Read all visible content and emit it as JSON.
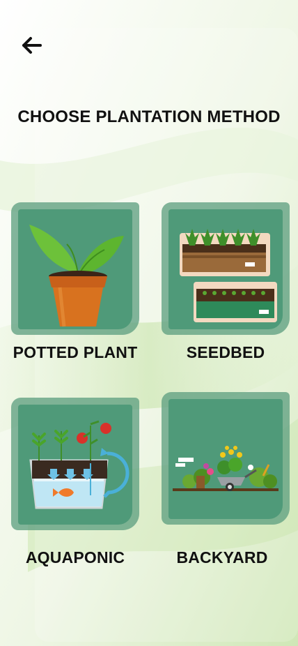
{
  "header": {
    "back_icon": "arrow-left-icon",
    "title": "CHOOSE PLANTATION METHOD"
  },
  "methods": [
    {
      "label": "POTTED PLANT",
      "icon": "potted-plant-icon"
    },
    {
      "label": "SEEDBED",
      "icon": "seedbed-icon"
    },
    {
      "label": "AQUAPONIC",
      "icon": "aquaponic-icon"
    },
    {
      "label": "BACKYARD",
      "icon": "backyard-icon"
    }
  ],
  "colors": {
    "card": "#4f9a79",
    "card_frame": "#60a082",
    "text": "#111111",
    "accent": "#2e8b3a"
  }
}
